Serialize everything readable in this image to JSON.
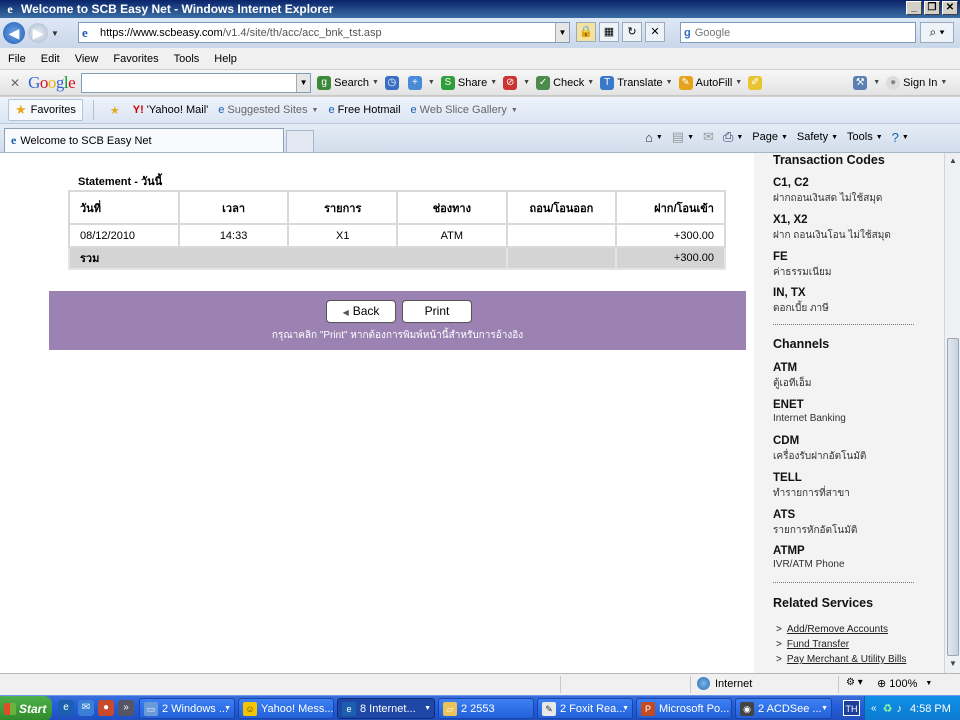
{
  "window": {
    "title": "Welcome to SCB Easy Net - Windows Internet Explorer"
  },
  "address": {
    "url_prefix": "https://",
    "url_host": "www.scbeasy.com",
    "url_path": "/v1.4/site/th/acc/acc_bnk_tst.asp",
    "search_placeholder": "Google"
  },
  "menu": [
    "File",
    "Edit",
    "View",
    "Favorites",
    "Tools",
    "Help"
  ],
  "google_toolbar": {
    "search": "Search",
    "share": "Share",
    "check": "Check",
    "translate": "Translate",
    "autofill": "AutoFill",
    "signin": "Sign In"
  },
  "favorites_bar": {
    "favorites": "Favorites",
    "items": [
      "'Yahoo! Mail'",
      "Suggested Sites",
      "Free Hotmail",
      "Web Slice Gallery"
    ]
  },
  "tab": {
    "label": "Welcome to SCB Easy Net"
  },
  "command_bar": {
    "page": "Page",
    "safety": "Safety",
    "tools": "Tools"
  },
  "statement": {
    "title": "Statement - วันนี้",
    "headers": [
      "วันที่",
      "เวลา",
      "รายการ",
      "ช่องทาง",
      "ถอน/โอนออก",
      "ฝาก/โอนเข้า"
    ],
    "rows": [
      [
        "08/12/2010",
        "14:33",
        "X1",
        "ATM",
        "",
        "+300.00"
      ]
    ],
    "total_label": "รวม",
    "total_value": "+300.00"
  },
  "actions": {
    "back": "Back",
    "print": "Print",
    "note": "กรุณาคลิก \"Print\" หากต้องการพิมพ์หน้านี้สำหรับการอ้างอิง"
  },
  "sidebar": {
    "transaction_codes_title": "Transaction Codes",
    "codes": [
      {
        "code": "C1, C2",
        "desc": "ฝากถอนเงินสด ไม่ใช้สมุด"
      },
      {
        "code": "X1, X2",
        "desc": "ฝาก ถอนเงินโอน ไม่ใช้สมุด"
      },
      {
        "code": "FE",
        "desc": "ค่าธรรมเนียม"
      },
      {
        "code": "IN, TX",
        "desc": "ดอกเบี้ย ภาษี"
      }
    ],
    "channels_title": "Channels",
    "channels": [
      {
        "code": "ATM",
        "desc": "ตู้เอทีเอ็ม"
      },
      {
        "code": "ENET",
        "desc": "Internet Banking"
      },
      {
        "code": "CDM",
        "desc": "เครื่องรับฝากอัตโนมัติ"
      },
      {
        "code": "TELL",
        "desc": "ทำรายการที่สาขา"
      },
      {
        "code": "ATS",
        "desc": "รายการหักอัตโนมัติ"
      },
      {
        "code": "ATMP",
        "desc": "IVR/ATM Phone"
      }
    ],
    "related_title": "Related Services",
    "related": [
      "Add/Remove Accounts",
      "Fund Transfer",
      "Pay Merchant & Utility Bills"
    ]
  },
  "status": {
    "zone": "Internet",
    "zoom": "100%"
  },
  "taskbar": {
    "start": "Start",
    "tasks": [
      "2 Windows ...",
      "Yahoo! Mess...",
      "8 Internet...",
      "2 2553",
      "2 Foxit Rea...",
      "Microsoft Po...",
      "2 ACDSee ..."
    ],
    "lang": "TH",
    "time": "4:58 PM"
  },
  "colors": {
    "purple_band": "#9b82b2",
    "total_row": "#d4d4d4",
    "sidebar_bg": "#f3f3f3"
  }
}
